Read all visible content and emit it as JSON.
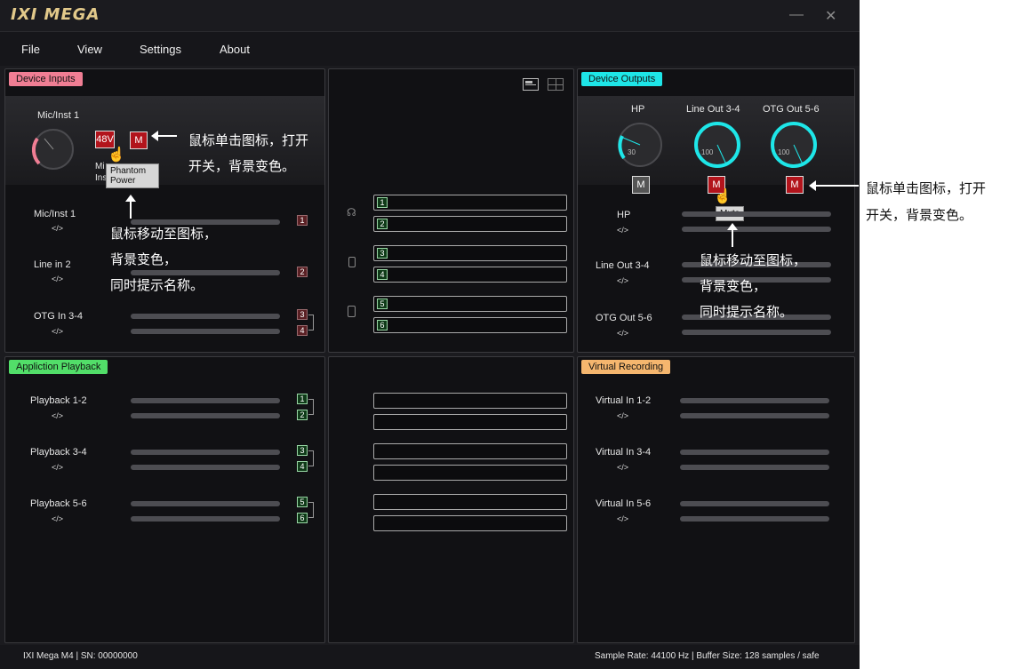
{
  "app": {
    "logo": "IXI MEGA",
    "minimize": "—",
    "close": "✕"
  },
  "menu": [
    "File",
    "View",
    "Settings",
    "About"
  ],
  "device_inputs": {
    "title": "Device Inputs",
    "knob_label": "Mic/Inst 1",
    "btn_48v": "48V",
    "btn_m": "M",
    "partial_label_1": "Mi",
    "partial_label_2": "Ins",
    "tooltip_line1": "Phantom",
    "tooltip_line2": "Power",
    "channels": [
      {
        "name": "Mic/Inst 1",
        "code": "</>",
        "num": "1"
      },
      {
        "name": "Line in 2",
        "code": "</>",
        "num": "2"
      },
      {
        "name": "OTG In 3-4",
        "code": "</>",
        "num_a": "3",
        "num_b": "4"
      }
    ]
  },
  "routing": {
    "nums": [
      "1",
      "2",
      "3",
      "4",
      "5",
      "6"
    ]
  },
  "device_outputs": {
    "title": "Device Outputs",
    "knobs": [
      {
        "label": "HP",
        "value": "30",
        "mute": "M"
      },
      {
        "label": "Line Out 3-4",
        "value": "100",
        "mute": "M"
      },
      {
        "label": "OTG Out 5-6",
        "value": "100",
        "mute": "M"
      }
    ],
    "tooltip": "Mute",
    "channels": [
      {
        "name": "HP",
        "code": "</>"
      },
      {
        "name": "Line Out 3-4",
        "code": "</>"
      },
      {
        "name": "OTG Out 5-6",
        "code": "</>"
      }
    ]
  },
  "playback": {
    "title": "Appliction Playback",
    "channels": [
      {
        "name": "Playback 1-2",
        "code": "</>",
        "num_a": "1",
        "num_b": "2"
      },
      {
        "name": "Playback 3-4",
        "code": "</>",
        "num_a": "3",
        "num_b": "4"
      },
      {
        "name": "Playback 5-6",
        "code": "</>",
        "num_a": "5",
        "num_b": "6"
      }
    ]
  },
  "virtual": {
    "title": "Virtual Recording",
    "channels": [
      {
        "name": "Virtual In 1-2",
        "code": "</>"
      },
      {
        "name": "Virtual In 3-4",
        "code": "</>"
      },
      {
        "name": "Virtual In 5-6",
        "code": "</>"
      }
    ]
  },
  "annotations": {
    "click_line1": "鼠标单击图标，打开",
    "click_line2": "开关，背景变色。",
    "hover_line1": "鼠标移动至图标，",
    "hover_line2": "背景变色，",
    "hover_line3": "同时提示名称。",
    "right_click_line1": "鼠标单击图标，打开",
    "right_click_line2": "开关，背景变色。",
    "right_hover_line1": "鼠标移动至图标，",
    "right_hover_line2": "背景变色，",
    "right_hover_line3": "同时提示名称。"
  },
  "status": {
    "left": "IXI Mega M4  |  SN: 00000000",
    "right": "Sample Rate: 44100 Hz |   Buffer Size: 128 samples / safe"
  },
  "colors": {
    "pink": "#f07e94",
    "cyan": "#1ee6e8",
    "green": "#52de69",
    "orange": "#f5b66e",
    "mute_red": "#b2141c"
  }
}
